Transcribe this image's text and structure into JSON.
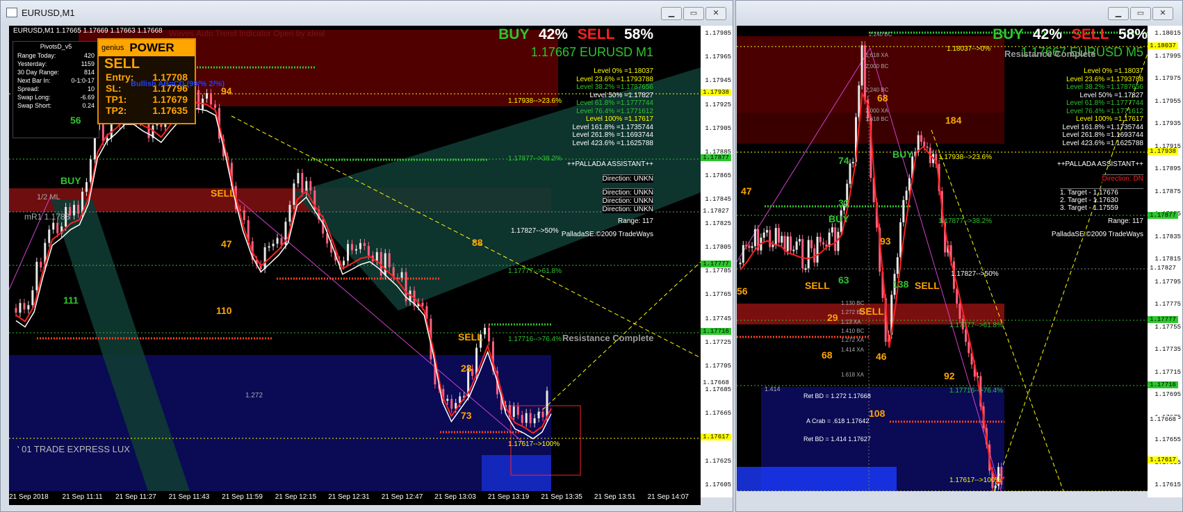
{
  "window1": {
    "title": "EURUSD,M1",
    "chart_header": "EURUSD,M1  1.17665 1.17669 1.17663 1.17668",
    "indicator_title": "Waves Auto Trend Indicator Open by ideal",
    "buy_label": "BUY",
    "buy_pct": "42%",
    "sell_label": "SELL",
    "sell_pct": "58%",
    "price_symbol": "1.17667 EURUSD M1",
    "levels": [
      {
        "text": "Level 0% =1.18037",
        "color": "#ffff00"
      },
      {
        "text": "Level 23.6% =1.1793788",
        "color": "#ffff00"
      },
      {
        "text": "Level 38.2% =1.1787656",
        "color": "#2ec52e"
      },
      {
        "text": "Level 50% =1.17827",
        "color": "#ffffff"
      },
      {
        "text": "Level 61.8% =1.1777744",
        "color": "#2ec52e"
      },
      {
        "text": "Level 76.4% =1.1771612",
        "color": "#2ec52e"
      },
      {
        "text": "Level 100% =1.17617",
        "color": "#ffff00"
      },
      {
        "text": "Level 161.8% =1.1735744",
        "color": "#ffffff"
      },
      {
        "text": "Level 261.8% =1.1693744",
        "color": "#ffffff"
      },
      {
        "text": "Level 423.6% =1.1625788",
        "color": "#ffffff"
      }
    ],
    "assistant": "++PALLADA ASSISTANT++",
    "directions": [
      "Direction: UNKN",
      "Direction: UNKN",
      "Direction: UNKN",
      "Direction: UNKN"
    ],
    "range": "Range: 117",
    "copyright": "PalladaSE.©2009 TradeWays",
    "pivots": {
      "title": "PivotsD_v5",
      "rows": [
        [
          "Range  Today:",
          "420"
        ],
        [
          "Yesterday:",
          "1159"
        ],
        [
          "30 Day Range:",
          "814"
        ],
        [
          "Next Bar In:",
          "0-1:0-17"
        ],
        [
          "Spread:",
          "10"
        ],
        [
          "Swap  Long:",
          "-6.69"
        ],
        [
          "Swap  Short:",
          "0.24"
        ]
      ]
    },
    "genius": {
      "brand": "genius",
      "title": "POWER",
      "signal": "SELL",
      "rows": [
        [
          "Entry:",
          "1.17708"
        ],
        [
          "SL:",
          "1.17796"
        ],
        [
          "TP1:",
          "1.17679"
        ],
        [
          "TP2:",
          "1.17635"
        ]
      ],
      "pattern": "Bullish AB=CD (99/% 2/%)"
    },
    "signals": [
      {
        "text": "BUY",
        "color": "#2ec52e"
      },
      {
        "text": "SELL",
        "color": "#ffa500"
      },
      {
        "text": "SELL",
        "color": "#ffa500"
      }
    ],
    "numbers": [
      "56",
      "94",
      "47",
      "88",
      "111",
      "110",
      "28",
      "73"
    ],
    "fibs": [
      "1.17938-->23.6%",
      "1.17877-->38.2%",
      "1.17827-->50%",
      "1.17777-->61.8%",
      "1.17716-->76.4%",
      "1.17617-->100%"
    ],
    "ml_label": "1/2 ML",
    "mr_label": "mR1  1.1783",
    "ratio_label": "1.272",
    "resistance": "Resistance Complete",
    "bottom_label": "' 01 TRADE EXPRESS LUX",
    "price_ticks": [
      "1.17985",
      "1.17965",
      "1.17945",
      "1.17925",
      "1.17905",
      "1.17885",
      "1.17865",
      "1.17845",
      "1.17825",
      "1.17805",
      "1.17785",
      "1.17765",
      "1.17745",
      "1.17725",
      "1.17705",
      "1.17685",
      "1.17665",
      "1.17645",
      "1.17625",
      "1.17605"
    ],
    "price_boxes": [
      {
        "text": "1.17938",
        "color": "#ffff00"
      },
      {
        "text": "1.17877",
        "color": "#2ec52e"
      },
      {
        "text": "1.17827",
        "color": "#ffffff"
      },
      {
        "text": "1.17777",
        "color": "#2ec52e"
      },
      {
        "text": "1.17716",
        "color": "#2ec52e"
      },
      {
        "text": "1.17668",
        "color": "#ffffff"
      },
      {
        "text": "1.17617",
        "color": "#ffff00"
      }
    ],
    "time_ticks": [
      "21 Sep 2018",
      "21 Sep 11:11",
      "21 Sep 11:27",
      "21 Sep 11:43",
      "21 Sep 11:59",
      "21 Sep 12:15",
      "21 Sep 12:31",
      "21 Sep 12:47",
      "21 Sep 13:03",
      "21 Sep 13:19",
      "21 Sep 13:35",
      "21 Sep 13:51",
      "21 Sep 14:07"
    ]
  },
  "window2": {
    "buy_label": "BUY",
    "buy_pct": "42%",
    "sell_label": "SELL",
    "sell_pct": "58%",
    "price_symbol": "1.17667 EURUSD M5",
    "resistance": "Resistance Complete",
    "levels": [
      {
        "text": "Level 0% =1.18037",
        "color": "#ffff00"
      },
      {
        "text": "Level 23.6% =1.1793788",
        "color": "#ffff00"
      },
      {
        "text": "Level 38.2% =1.1787656",
        "color": "#2ec52e"
      },
      {
        "text": "Level 50% =1.17827",
        "color": "#ffffff"
      },
      {
        "text": "Level 61.8% =1.1777744",
        "color": "#2ec52e"
      },
      {
        "text": "Level 76.4% =1.1771612",
        "color": "#2ec52e"
      },
      {
        "text": "Level 100% =1.17617",
        "color": "#ffff00"
      },
      {
        "text": "Level 161.8% =1.1735744",
        "color": "#ffffff"
      },
      {
        "text": "Level 261.8% =1.1693744",
        "color": "#ffffff"
      },
      {
        "text": "Level 423.6% =1.1625788",
        "color": "#ffffff"
      }
    ],
    "assistant": "++PALLADA ASSISTANT++",
    "direction": "Direction: DN",
    "targets": [
      "1. Target - 1.17676",
      "2. Target - 1.17630",
      "3. Target - 1.17559"
    ],
    "range": "Range: 117",
    "copyright": "PalladaSE.©2009 TradeWays",
    "fibs": [
      "1.18037-->0%",
      "1.17938-->23.6%",
      "1.17877-->38.2%",
      "1.17827-->50%",
      "1.17777-->61.8%",
      "1.17716-->76.4%",
      "1.17617-->100%"
    ],
    "numbers": [
      "68",
      "184",
      "74",
      "32",
      "93",
      "63",
      "138",
      "29",
      "46",
      "68",
      "92",
      "108",
      "47",
      "56"
    ],
    "signals": [
      {
        "text": "BUY",
        "color": "#2ec52e"
      },
      {
        "text": "BUY",
        "color": "#2ec52e"
      },
      {
        "text": "SELL",
        "color": "#ffa500"
      },
      {
        "text": "SELL",
        "color": "#ffa500"
      },
      {
        "text": "SELL",
        "color": "#ffa500"
      }
    ],
    "harmonic_labels": [
      "2.240 BC",
      "1.618 XA",
      "2.000 BC",
      "2.240 BC",
      "2.000 XA",
      "1.618 BC",
      "1.130 BC",
      "1.272 BC",
      "1.13 XA",
      "1.410 BC",
      "1.272 XA",
      "1.414 XA",
      "1.618 XA"
    ],
    "ratio_notes": [
      "Ret BD = 1.272  1.17668",
      "A Crab = .618  1.17642",
      "Ret BD = 1.414  1.17627"
    ],
    "ratio_small": "1.414",
    "price_ticks": [
      "1.18015",
      "1.17995",
      "1.17975",
      "1.17955",
      "1.17935",
      "1.17915",
      "1.17895",
      "1.17875",
      "1.17855",
      "1.17835",
      "1.17815",
      "1.17795",
      "1.17775",
      "1.17755",
      "1.17735",
      "1.17715",
      "1.17695",
      "1.17675",
      "1.17655",
      "1.17635",
      "1.17615"
    ],
    "price_boxes": [
      {
        "text": "1.18037",
        "color": "#ffff00"
      },
      {
        "text": "1.17938",
        "color": "#ffff00"
      },
      {
        "text": "1.17877",
        "color": "#2ec52e"
      },
      {
        "text": "1.17827",
        "color": "#ffffff"
      },
      {
        "text": "1.17777",
        "color": "#2ec52e"
      },
      {
        "text": "1.17716",
        "color": "#2ec52e"
      },
      {
        "text": "1.17668",
        "color": "#ffffff"
      },
      {
        "text": "1.17617",
        "color": "#ffff00"
      }
    ]
  }
}
